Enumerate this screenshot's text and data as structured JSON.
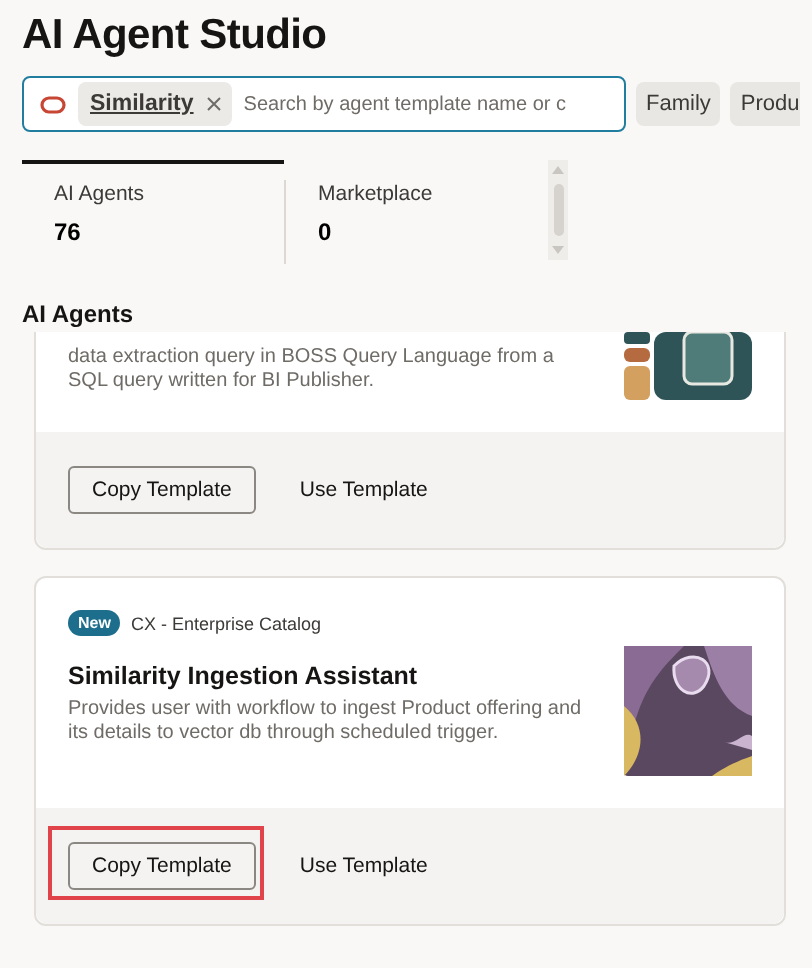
{
  "title": "AI Agent Studio",
  "search": {
    "chips": [
      {
        "label": "Similarity"
      }
    ],
    "placeholder": "Search by agent template name or c"
  },
  "filters": [
    {
      "label": "Family"
    },
    {
      "label": "Produ"
    }
  ],
  "tabs": [
    {
      "label": "AI Agents",
      "count": "76",
      "selected": true
    },
    {
      "label": "Marketplace",
      "count": "0",
      "selected": false
    }
  ],
  "section_title": "AI Agents",
  "cards": [
    {
      "description": "data extraction query in BOSS Query Language from a SQL query written for BI Publisher.",
      "actions": [
        "Copy Template",
        "Use Template"
      ],
      "highlighted": false
    },
    {
      "badge": "New",
      "category": "CX - Enterprise Catalog",
      "title": "Similarity Ingestion Assistant",
      "description": "Provides user with workflow to ingest Product offering and its details to vector db through scheduled trigger.",
      "actions": [
        "Copy Template",
        "Use Template"
      ],
      "highlighted": true
    }
  ]
}
